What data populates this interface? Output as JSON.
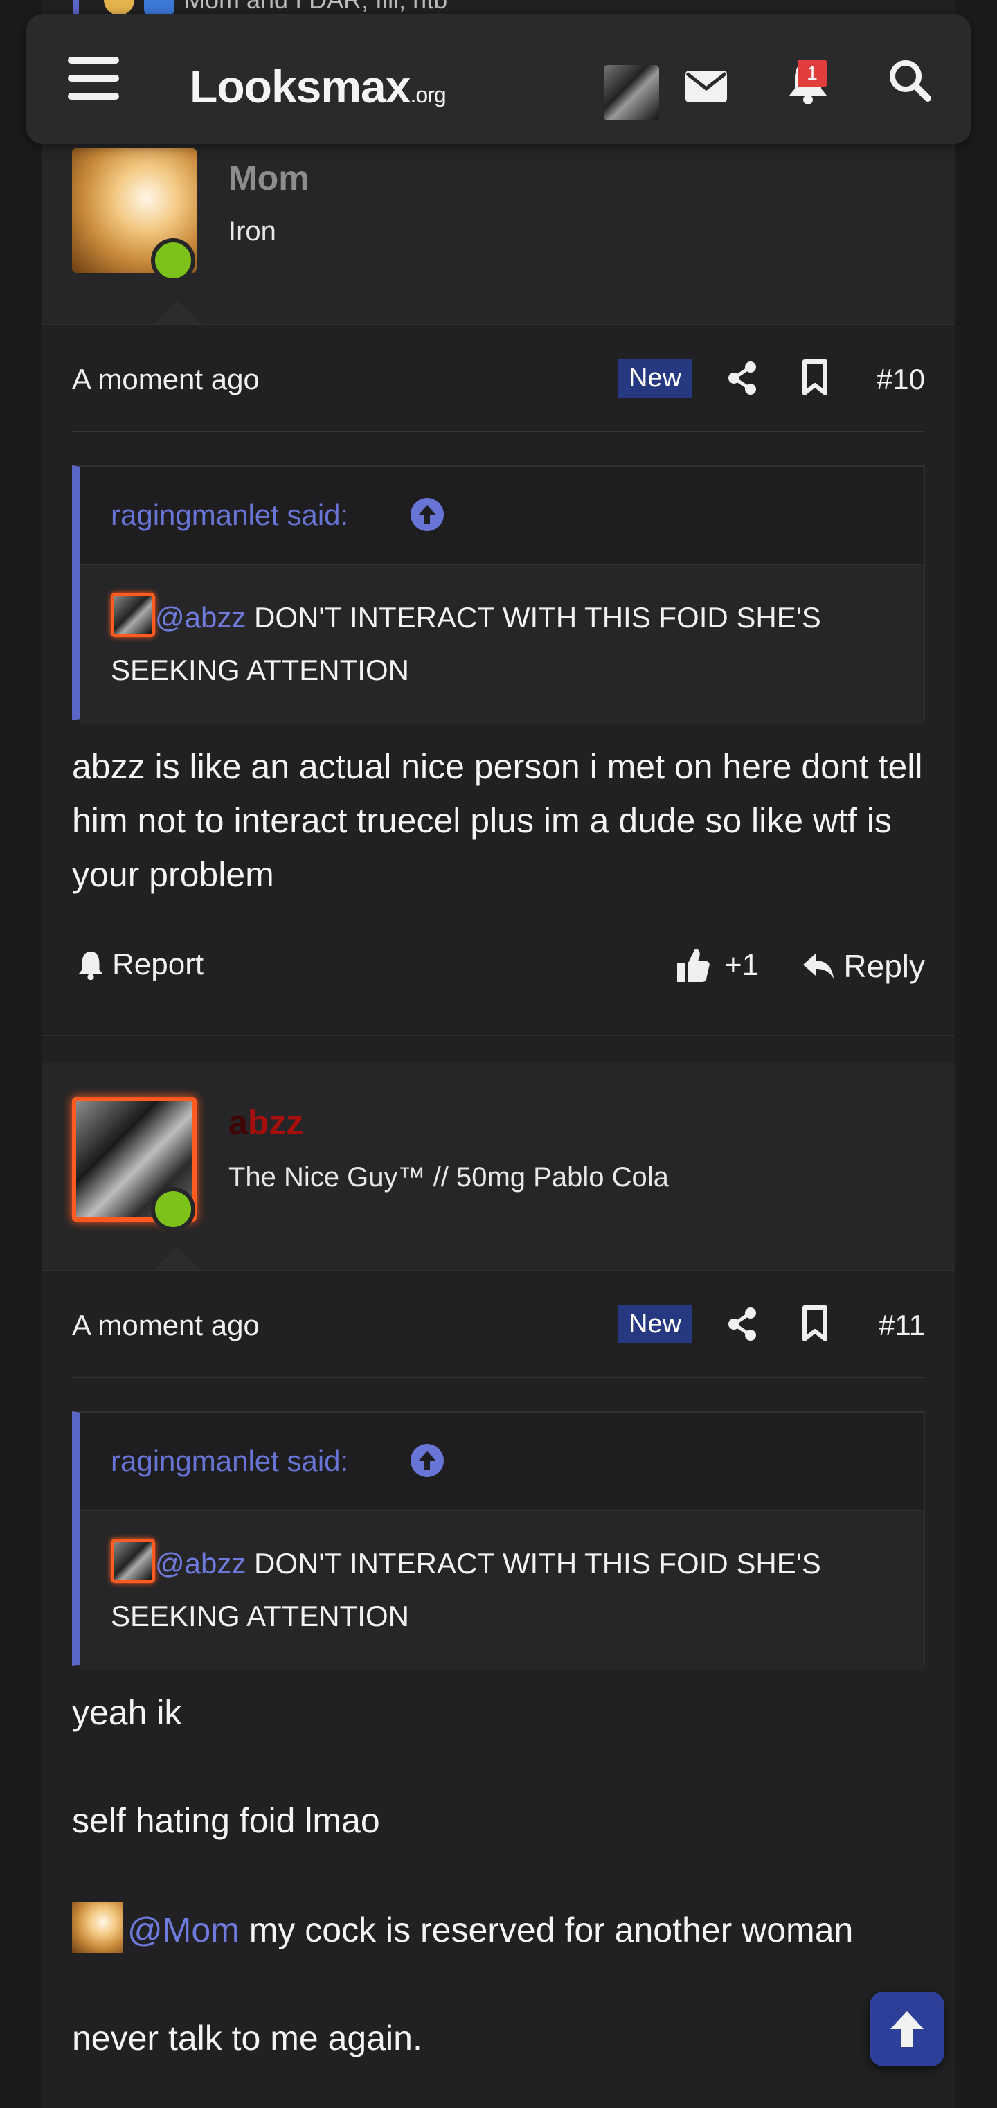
{
  "header": {
    "logo_main": "Looksmax",
    "logo_suffix": ".org",
    "notification_count": "1",
    "icons": [
      "menu-icon",
      "envelope-icon",
      "bell-icon",
      "search-icon"
    ]
  },
  "peek": {
    "text": "Mom and I DAR, fill, htb"
  },
  "posts": [
    {
      "username": "Mom",
      "username_color": "#8d8d8d",
      "user_title": "Iron",
      "time": "A moment ago",
      "new_label": "New",
      "post_number": "#10",
      "quote": {
        "author": "ragingmanlet said:",
        "mention": "@abzz",
        "text": " DON'T INTERACT WITH THIS FOID SHE'S SEEKING ATTENTION"
      },
      "body": [
        "abzz is like an actual nice person i met on here dont tell him not to interact truecel plus im a dude so like wtf is your problem"
      ],
      "actions": {
        "report": "Report",
        "reaction": "+1",
        "reply": "Reply"
      }
    },
    {
      "username_first": "a",
      "username_rest": "bzz",
      "username_color": "#a70f0f",
      "user_title": "The Nice Guy™ // 50mg Pablo Cola",
      "time": "A moment ago",
      "new_label": "New",
      "post_number": "#11",
      "quote": {
        "author": "ragingmanlet said:",
        "mention": "@abzz",
        "text": " DON'T INTERACT WITH THIS FOID SHE'S SEEKING ATTENTION"
      },
      "body": {
        "line1": "yeah ik",
        "line2": "self hating foid lmao",
        "mention": "@Mom",
        "line3": " my cock is reserved for another woman",
        "line4": "never talk to me again."
      }
    }
  ],
  "colors": {
    "accent": "#5a66c8",
    "mention": "#6f7bdc",
    "online": "#7cc21b",
    "new_badge": "#26387f",
    "scroll_button": "#2e3f9a"
  }
}
